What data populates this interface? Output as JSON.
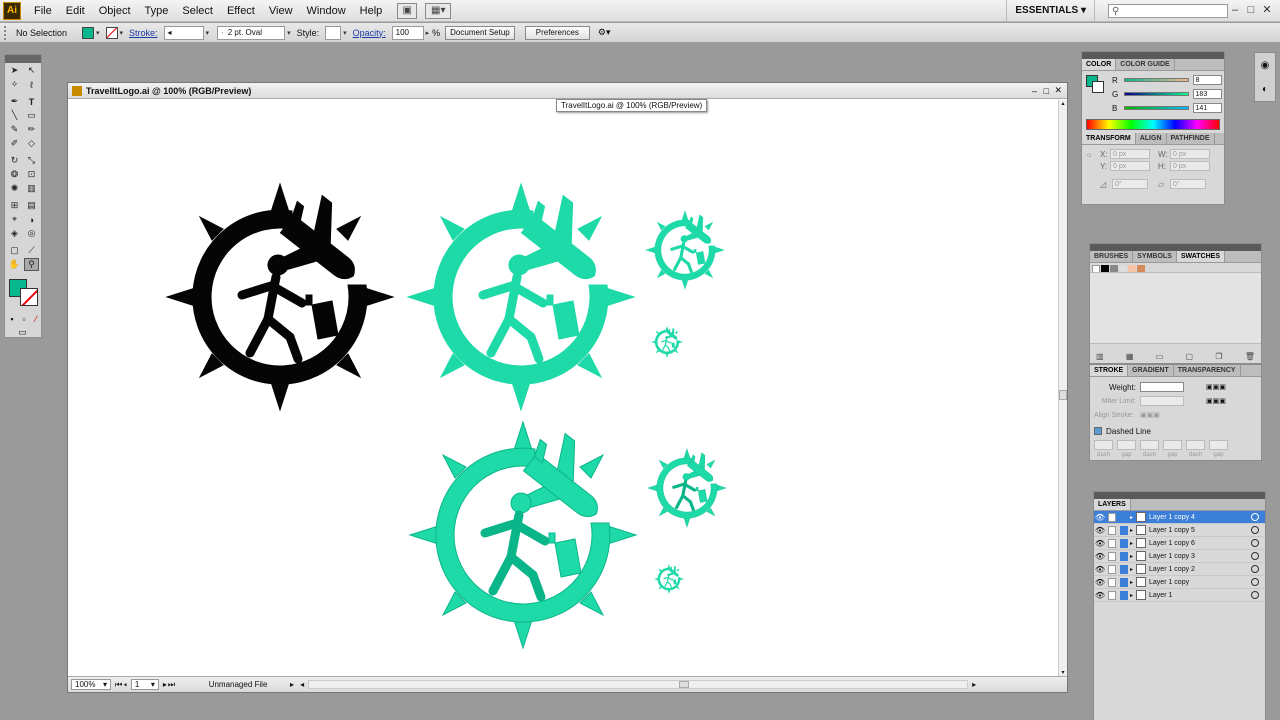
{
  "menubar": {
    "logo": "Ai",
    "items": [
      "File",
      "Edit",
      "Object",
      "Type",
      "Select",
      "Effect",
      "View",
      "Window",
      "Help"
    ],
    "workspace": "ESSENTIALS",
    "search_placeholder": ""
  },
  "controlbar": {
    "selection": "No Selection",
    "fill_color": "#08b78d",
    "stroke_label": "Stroke:",
    "brush": "2 pt. Oval",
    "style_label": "Style:",
    "opacity_label": "Opacity:",
    "opacity_value": "100",
    "opacity_unit": "%",
    "document_setup": "Document Setup",
    "preferences": "Preferences"
  },
  "document": {
    "title": "TravelItLogo.ai @ 100% (RGB/Preview)",
    "tooltip": "TravelItLogo.ai @ 100% (RGB/Preview)",
    "zoom": "100%",
    "artboard": "1",
    "status": "Unmanaged File"
  },
  "color_panel": {
    "tabs": [
      "COLOR",
      "COLOR GUIDE"
    ],
    "channels": [
      {
        "label": "R",
        "value": "8"
      },
      {
        "label": "G",
        "value": "183"
      },
      {
        "label": "B",
        "value": "141"
      }
    ]
  },
  "transform_panel": {
    "tabs": [
      "TRANSFORM",
      "ALIGN",
      "PATHFINDE"
    ],
    "x_label": "X:",
    "x_value": "0 px",
    "y_label": "Y:",
    "y_value": "0 px",
    "w_label": "W:",
    "w_value": "0 px",
    "h_label": "H:",
    "h_value": "0 px",
    "rotate_value": "0°",
    "shear_value": "0°"
  },
  "swatches_panel": {
    "tabs": [
      "BRUSHES",
      "SYMBOLS",
      "SWATCHES"
    ]
  },
  "stroke_panel": {
    "tabs": [
      "STROKE",
      "GRADIENT",
      "TRANSPARENCY"
    ],
    "weight_label": "Weight:",
    "miter_label": "Miter Limit:",
    "align_label": "Align Stroke:",
    "dashed_label": "Dashed Line",
    "dash_labels": [
      "dash",
      "gap",
      "dash",
      "gap",
      "dash",
      "gap"
    ]
  },
  "layers_panel": {
    "title": "LAYERS",
    "layers": [
      {
        "name": "Layer 1 copy 4",
        "selected": true
      },
      {
        "name": "Layer 1 copy 5",
        "selected": false
      },
      {
        "name": "Layer 1 copy 6",
        "selected": false
      },
      {
        "name": "Layer 1 copy 3",
        "selected": false
      },
      {
        "name": "Layer 1 copy 2",
        "selected": false
      },
      {
        "name": "Layer 1 copy",
        "selected": false
      },
      {
        "name": "Layer 1",
        "selected": false
      }
    ]
  },
  "colors": {
    "logo_black": "#050505",
    "logo_teal": "#1ed9a8",
    "logo_dark_teal": "#0bb58a",
    "layer_highlight": "#3c7fd8"
  }
}
